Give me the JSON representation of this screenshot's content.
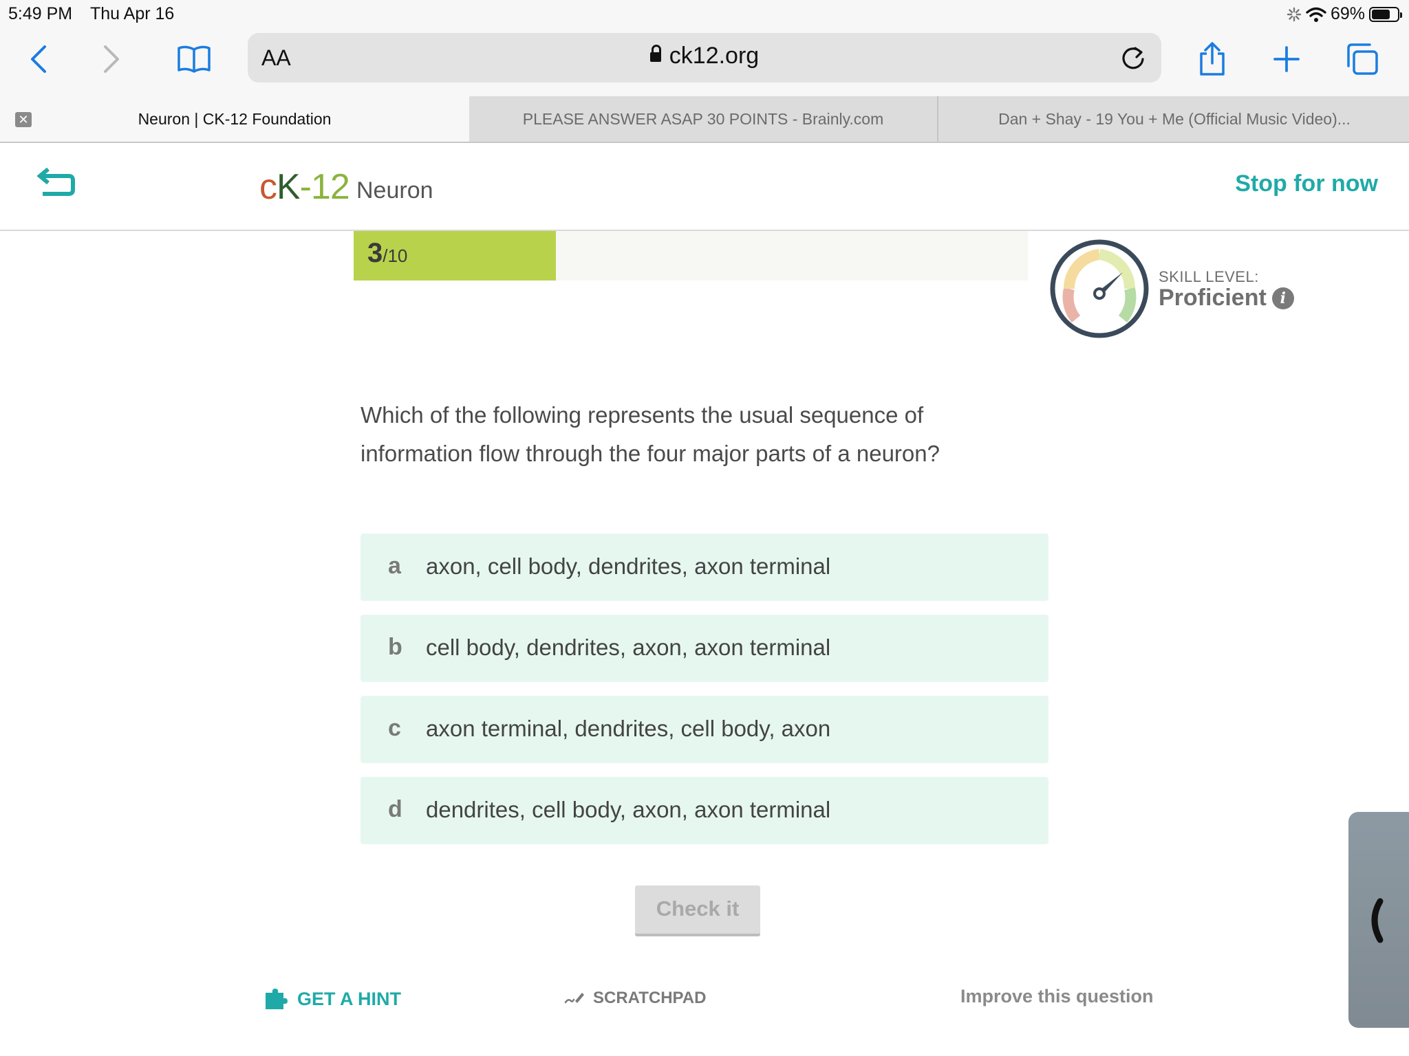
{
  "status_bar": {
    "time": "5:49 PM",
    "date": "Thu Apr 16",
    "battery": "69%"
  },
  "browser": {
    "reader_label": "AA",
    "url": "ck12.org",
    "tabs": [
      {
        "label": "Neuron | CK-12 Foundation",
        "active": true
      },
      {
        "label": "PLEASE ANSWER ASAP 30 POINTS - Brainly.com",
        "active": false
      },
      {
        "label": "Dan + Shay - 19 You + Me (Official Music Video)...",
        "active": false
      }
    ],
    "icons": [
      "chevron-left-icon",
      "chevron-right-icon",
      "bookmarks-icon",
      "reload-icon",
      "share-icon",
      "plus-icon",
      "tabs-icon"
    ]
  },
  "header": {
    "logo": "cK-12",
    "title": "Neuron",
    "stop_label": "Stop for now"
  },
  "progress": {
    "current": "3",
    "total": "/10",
    "fraction": 0.3
  },
  "skill": {
    "label": "SKILL LEVEL:",
    "value": "Proficient"
  },
  "question": {
    "text": "Which of the following represents the usual sequence of information flow through the four major parts of a neuron?",
    "options": [
      {
        "letter": "a",
        "text": "axon, cell body, dendrites, axon terminal"
      },
      {
        "letter": "b",
        "text": "cell body, dendrites, axon, axon terminal"
      },
      {
        "letter": "c",
        "text": "axon terminal, dendrites, cell body, axon"
      },
      {
        "letter": "d",
        "text": "dendrites, cell body, axon, axon terminal"
      }
    ],
    "check_label": "Check it"
  },
  "footer": {
    "hint_label": "GET A HINT",
    "scratch_label": "SCRATCHPAD",
    "improve_label": "Improve this question"
  },
  "colors": {
    "accent": "#1faaa7",
    "progress": "#b8d24c",
    "option_bg": "#e6f7f0",
    "ios_blue": "#1a7de0"
  }
}
